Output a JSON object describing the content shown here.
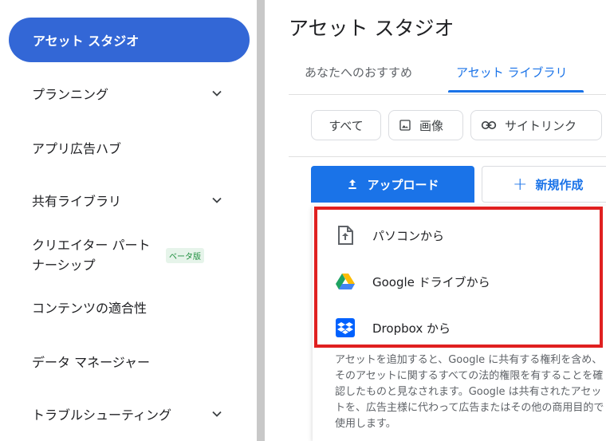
{
  "sidebar": {
    "items": [
      {
        "label": "アセット スタジオ",
        "active": true
      },
      {
        "label": "プランニング",
        "expandable": true
      },
      {
        "label": "アプリ広告ハブ"
      },
      {
        "label": "共有ライブラリ",
        "expandable": true
      },
      {
        "label": "クリエイター パート",
        "label_line2": "ナーシップ",
        "badge": "ベータ版"
      },
      {
        "label": "コンテンツの適合性"
      },
      {
        "label": "データ マネージャー"
      },
      {
        "label": "トラブルシューティング",
        "expandable": true
      }
    ]
  },
  "main": {
    "title": "アセット スタジオ",
    "tabs": [
      {
        "label": "あなたへのおすすめ",
        "active": false
      },
      {
        "label": "アセット ライブラリ",
        "active": true
      }
    ],
    "filters": [
      {
        "label": "すべて"
      },
      {
        "label": "画像",
        "icon": "image-icon"
      },
      {
        "label": "サイトリンク",
        "icon": "link-icon"
      }
    ],
    "upload_label": "アップロード",
    "new_label": "新規作成",
    "upload_menu": [
      {
        "label": "パソコンから",
        "icon": "computer-upload-icon"
      },
      {
        "label": "Google ドライブから",
        "icon": "google-drive-icon"
      },
      {
        "label": "Dropbox から",
        "icon": "dropbox-icon"
      }
    ],
    "disclaimer": "アセットを追加すると、Google に共有する権利を含め、そのアセットに関するすべての法的権限を有することを確認したものと見なされます。Google は共有されたアセットを、広告主様に代わって広告またはその他の商用目的で使用します。"
  },
  "colors": {
    "accent": "#1a73e8",
    "active_nav": "#3367d6",
    "highlight": "#e02020"
  }
}
